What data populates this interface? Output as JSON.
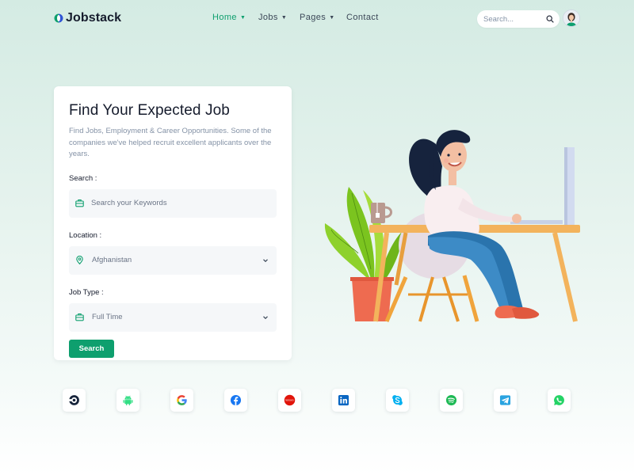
{
  "brand": {
    "name": "Jobstack"
  },
  "nav": {
    "items": [
      {
        "label": "Home",
        "dropdown": true,
        "active": true
      },
      {
        "label": "Jobs",
        "dropdown": true,
        "active": false
      },
      {
        "label": "Pages",
        "dropdown": true,
        "active": false
      },
      {
        "label": "Contact",
        "dropdown": false,
        "active": false
      }
    ]
  },
  "header_search": {
    "placeholder": "Search..."
  },
  "hero": {
    "title": "Find Your Expected Job",
    "description": "Find Jobs, Employment & Career Opportunities. Some of the companies we've helped recruit excellent applicants over the years."
  },
  "form": {
    "search_label": "Search :",
    "search_placeholder": "Search your Keywords",
    "location_label": "Location :",
    "location_value": "Afghanistan",
    "jobtype_label": "Job Type :",
    "jobtype_value": "Full Time",
    "submit_label": "Search"
  },
  "colors": {
    "accent": "#0e9f6e",
    "text": "#161c2d",
    "muted": "#8492a6"
  },
  "companies": [
    {
      "icon": "circleci-icon"
    },
    {
      "icon": "android-icon"
    },
    {
      "icon": "google-icon"
    },
    {
      "icon": "facebook-icon"
    },
    {
      "icon": "lenovo-icon",
      "text": "lenovo"
    },
    {
      "icon": "linkedin-icon"
    },
    {
      "icon": "skype-icon"
    },
    {
      "icon": "spotify-icon"
    },
    {
      "icon": "telegram-icon"
    },
    {
      "icon": "whatsapp-icon"
    }
  ]
}
